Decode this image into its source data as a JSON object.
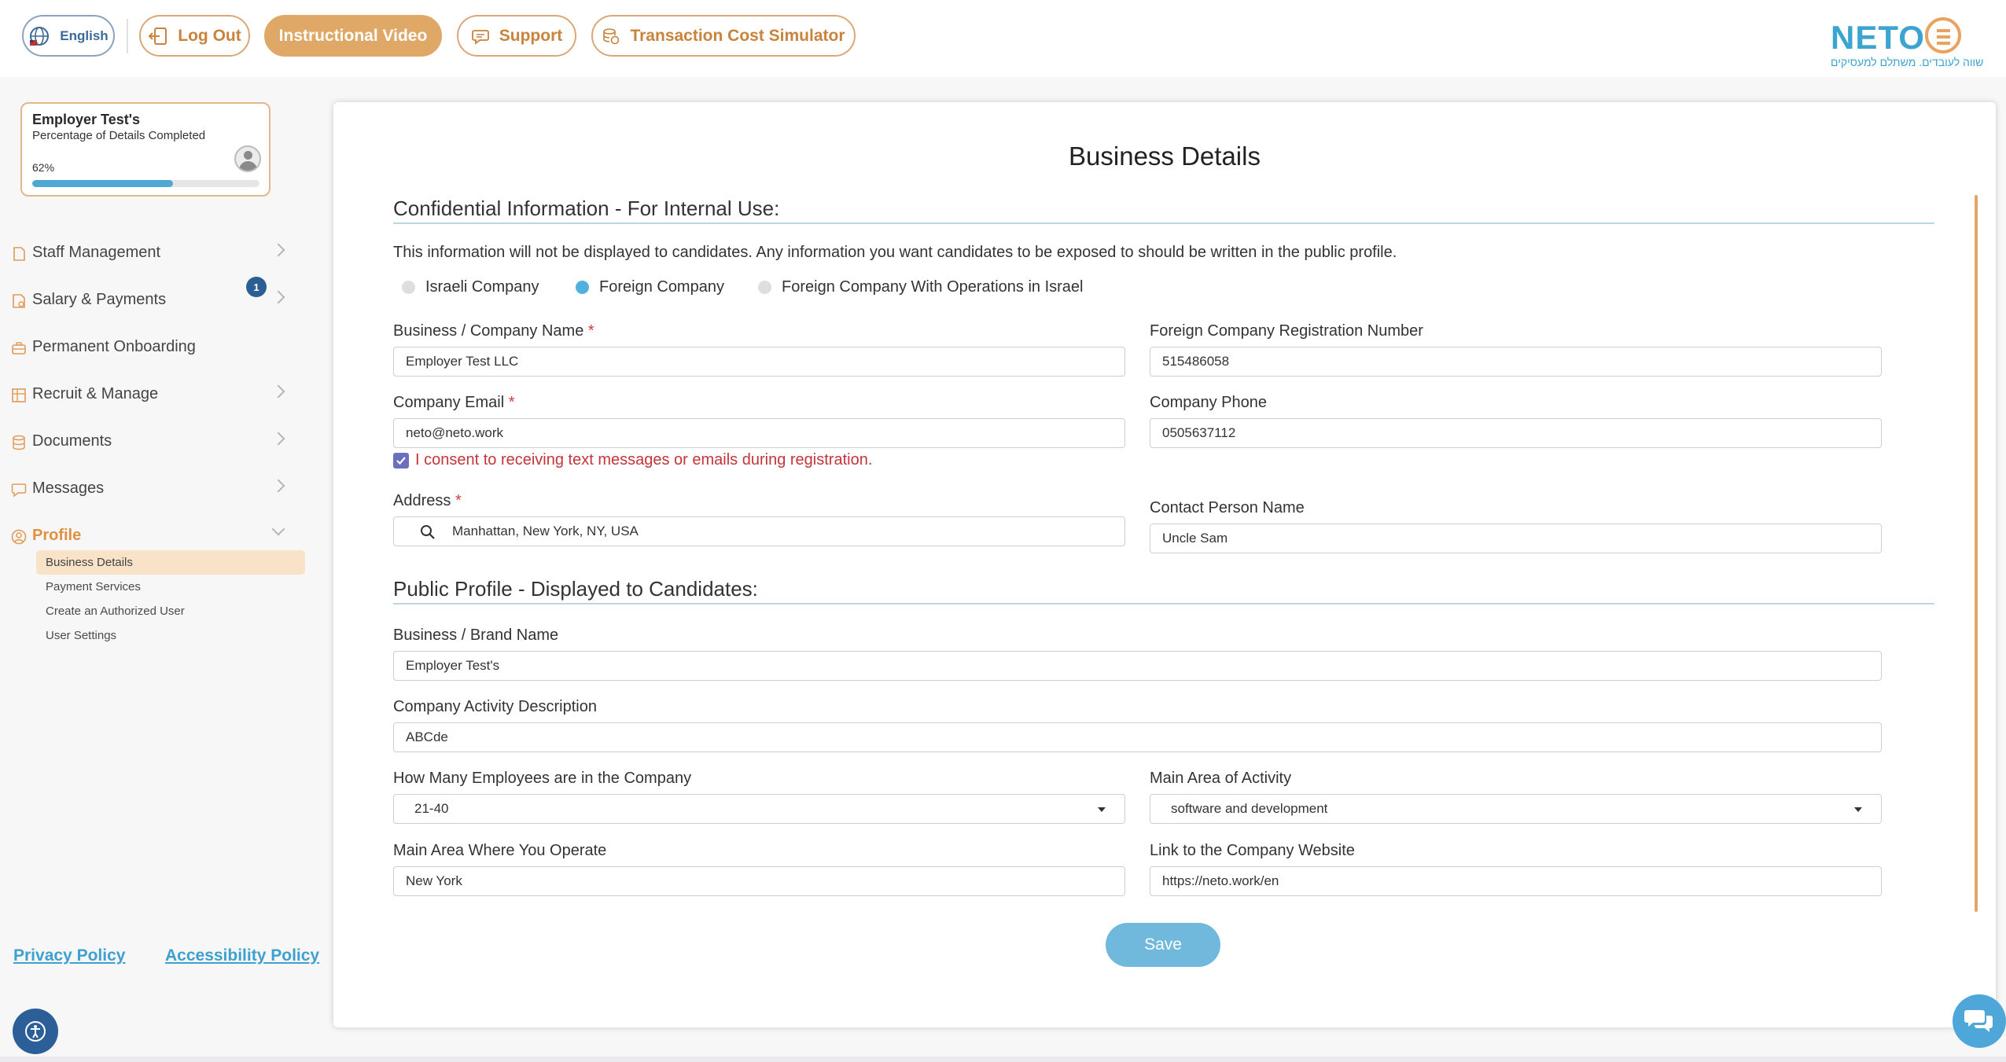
{
  "header": {
    "language": "English",
    "logout": "Log Out",
    "instructional_video": "Instructional Video",
    "support": "Support",
    "transaction_simulator": "Transaction Cost Simulator",
    "logo_word": "NETO",
    "logo_tagline": "שווה לעובדים. משתלם למעסיקים"
  },
  "profile_card": {
    "name": "Employer Test's",
    "subtitle": "Percentage of Details Completed",
    "percent_label": "62%",
    "percent_value": 0.62
  },
  "sidebar": {
    "items": [
      {
        "label": "Staff Management",
        "icon": "staff-icon"
      },
      {
        "label": "Salary & Payments",
        "icon": "salary-icon",
        "badge": "1"
      },
      {
        "label": "Permanent Onboarding",
        "icon": "briefcase-icon"
      },
      {
        "label": "Recruit & Manage",
        "icon": "grid-icon"
      },
      {
        "label": "Documents",
        "icon": "documents-icon"
      },
      {
        "label": "Messages",
        "icon": "messages-icon"
      },
      {
        "label": "Profile",
        "icon": "profile-icon"
      }
    ],
    "subitems": [
      "Business Details",
      "Payment Services",
      "Create an Authorized User",
      "User Settings"
    ],
    "privacy_policy": "Privacy Policy",
    "accessibility_policy": "Accessibility Policy"
  },
  "form": {
    "title": "Business Details",
    "confidential_title": "Confidential Information - For Internal Use:",
    "confidential_note": "This information will not be displayed to candidates. Any information you want candidates to be exposed to should be written in the public profile.",
    "company_types": [
      "Israeli Company",
      "Foreign Company",
      "Foreign Company With Operations in Israel"
    ],
    "selected_company_type": "Foreign Company",
    "company_name_label": "Business / Company Name",
    "company_name": "Employer Test LLC",
    "reg_number_label": "Foreign Company Registration Number",
    "reg_number": "515486058",
    "email_label": "Company Email",
    "email": "neto@neto.work",
    "phone_label": "Company Phone",
    "phone": "0505637112",
    "consent": "I consent to receiving text messages or emails during registration.",
    "address_label": "Address",
    "address": "Manhattan, New York, NY, USA",
    "contact_label": "Contact Person Name",
    "contact": "Uncle Sam",
    "public_title": "Public Profile - Displayed to Candidates:",
    "brand_label": "Business / Brand Name",
    "brand": "Employer Test's",
    "activity_desc_label": "Company Activity Description",
    "activity_desc": "ABCde",
    "employees_label": "How Many Employees are in the Company",
    "employees": "21-40",
    "main_activity_label": "Main Area of Activity",
    "main_activity": "software and development",
    "operate_area_label": "Main Area Where You Operate",
    "operate_area": "New York",
    "website_label": "Link to the Company Website",
    "website": "https://neto.work/en",
    "required_mark": "*",
    "save": "Save"
  },
  "colors": {
    "accent_orange": "#e0a866",
    "accent_blue": "#4fb1dc",
    "required_red": "#d13b3b"
  }
}
